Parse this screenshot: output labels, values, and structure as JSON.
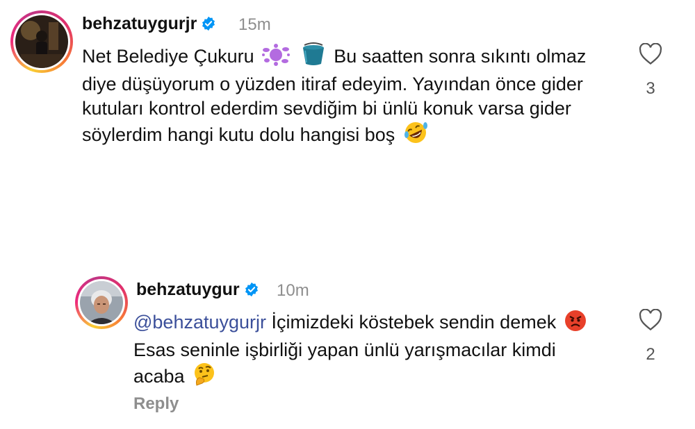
{
  "comments": [
    {
      "username": "behzatuygurjr",
      "time": "15m",
      "text_before": "Net Belediye Çukuru",
      "text_after": "Bu saatten sonra sıkıntı olmaz diye düşüyorum o yüzden itiraf edeyim. Yayından önce gider kutuları kontrol ederdim sevdiğim bi ünlü konuk varsa gider söylerdim hangi kutu dolu hangisi boş",
      "likes": "3",
      "avatar_icon": "profile-photo-dark-room",
      "emojis": [
        "splat-emoji",
        "bucket-emoji",
        "rofl-emoji"
      ]
    },
    {
      "username": "behzatuygur",
      "time": "10m",
      "mention": "@behzatuygurjr",
      "text_part1": "İçimizdeki köstebek sendin demek",
      "text_part2": "Esas seninle  işbirliği yapan ünlü yarışmacılar kimdi acaba",
      "likes": "2",
      "reply_label": "Reply",
      "avatar_icon": "profile-photo-man-grey-hair",
      "emojis": [
        "angry-face-emoji",
        "thinking-face-emoji"
      ]
    }
  ],
  "colors": {
    "verified": "#0095f6",
    "mention": "#3b4f9a",
    "muted": "#8e8e8e"
  }
}
